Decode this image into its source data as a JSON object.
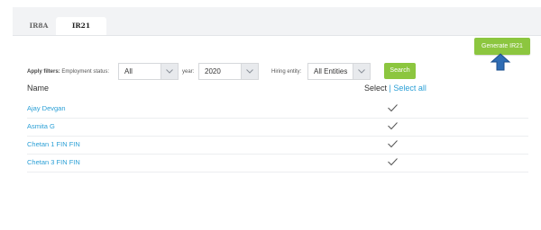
{
  "tabs": [
    {
      "label": "IR8A",
      "active": false
    },
    {
      "label": "IR21",
      "active": true
    }
  ],
  "generate_button": "Generate IR21",
  "filters": {
    "prefix": "Apply filters:",
    "employment_status_label": "Employment status:",
    "employment_status_value": "All",
    "year_label": "year:",
    "year_value": "2020",
    "hiring_entity_label": "Hiring entity:",
    "hiring_entity_value": "All Entities",
    "search_label": "Search"
  },
  "table": {
    "name_header": "Name",
    "select_header": "Select",
    "separator": "|",
    "select_all": "Select all",
    "rows": [
      {
        "name": "Ajay Devgan",
        "checked": true
      },
      {
        "name": "Asmita G",
        "checked": true
      },
      {
        "name": "Chetan 1 FIN FIN",
        "checked": true
      },
      {
        "name": "Chetan 3 FIN FIN",
        "checked": true
      }
    ]
  },
  "colors": {
    "accent_green": "#8cc63f",
    "link_blue": "#2a9fd6",
    "arrow_blue": "#2f6db5"
  },
  "icons": {
    "arrow": "up-arrow-icon",
    "checkbox": "checkmark-icon",
    "dropdown": "chevron-down-icon"
  }
}
